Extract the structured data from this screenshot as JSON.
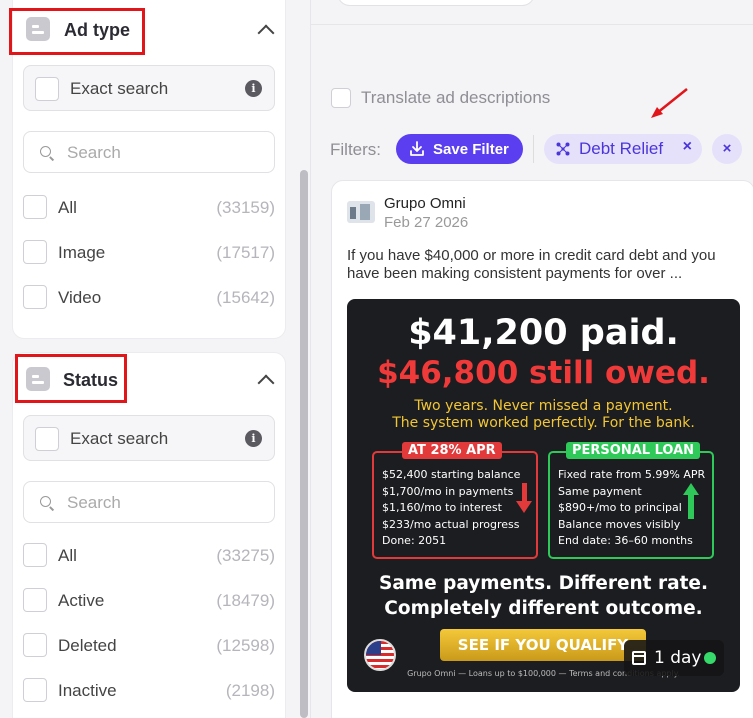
{
  "sidebar": {
    "ad_type": {
      "title": "Ad type",
      "exact_search_label": "Exact search",
      "search_placeholder": "Search",
      "options": [
        {
          "label": "All",
          "count": "(33159)"
        },
        {
          "label": "Image",
          "count": "(17517)"
        },
        {
          "label": "Video",
          "count": "(15642)"
        }
      ]
    },
    "status": {
      "title": "Status",
      "exact_search_label": "Exact search",
      "search_placeholder": "Search",
      "options": [
        {
          "label": "All",
          "count": "(33275)"
        },
        {
          "label": "Active",
          "count": "(18479)"
        },
        {
          "label": "Deleted",
          "count": "(12598)"
        },
        {
          "label": "Inactive",
          "count": "(2198)"
        }
      ]
    }
  },
  "main": {
    "translate_label": "Translate ad descriptions",
    "filters_label": "Filters:",
    "save_filter_label": "Save Filter",
    "active_filter_chip": "Debt Relief",
    "chip_remove": "×",
    "clear_all": "×"
  },
  "ad": {
    "advertiser": "Grupo Omni",
    "date": "Feb 27 2026",
    "text": "If you have $40,000 or more in credit card debt and you have been making consistent payments for over ...",
    "creative": {
      "headline1": "$41,200 paid.",
      "headline2": "$46,800 still owed.",
      "sub1": "Two years. Never missed a payment.",
      "sub2": "The system worked perfectly. For the bank.",
      "left_box": {
        "tag": "AT 28% APR",
        "lines": [
          "$52,400 starting balance",
          "$1,700/mo in payments",
          "$1,160/mo to interest",
          "$233/mo actual progress",
          "Done: 2051"
        ]
      },
      "right_box": {
        "tag": "PERSONAL LOAN",
        "lines": [
          "Fixed rate from 5.99% APR",
          "Same payment",
          "$890+/mo to principal",
          "Balance moves visibly",
          "End date: 36–60 months"
        ]
      },
      "bottom1": "Same payments. Different rate.",
      "bottom2": "Completely different outcome.",
      "cta": "SEE IF YOU QUALIFY",
      "footer": "Grupo Omni — Loans up to $100,000 — Terms and conditions apply."
    },
    "duration": "1 day"
  },
  "colors": {
    "accent": "#5a3ef0",
    "chip_bg": "#e5e1fb",
    "highlight_red": "#e0161a",
    "live": "#36d96a"
  },
  "icons": [
    "ad-type-icon",
    "status-icon",
    "chevron-up-icon",
    "info-icon",
    "search-icon",
    "download-icon",
    "filter-chip-icon",
    "close-icon",
    "calendar-icon",
    "flag-icon"
  ]
}
